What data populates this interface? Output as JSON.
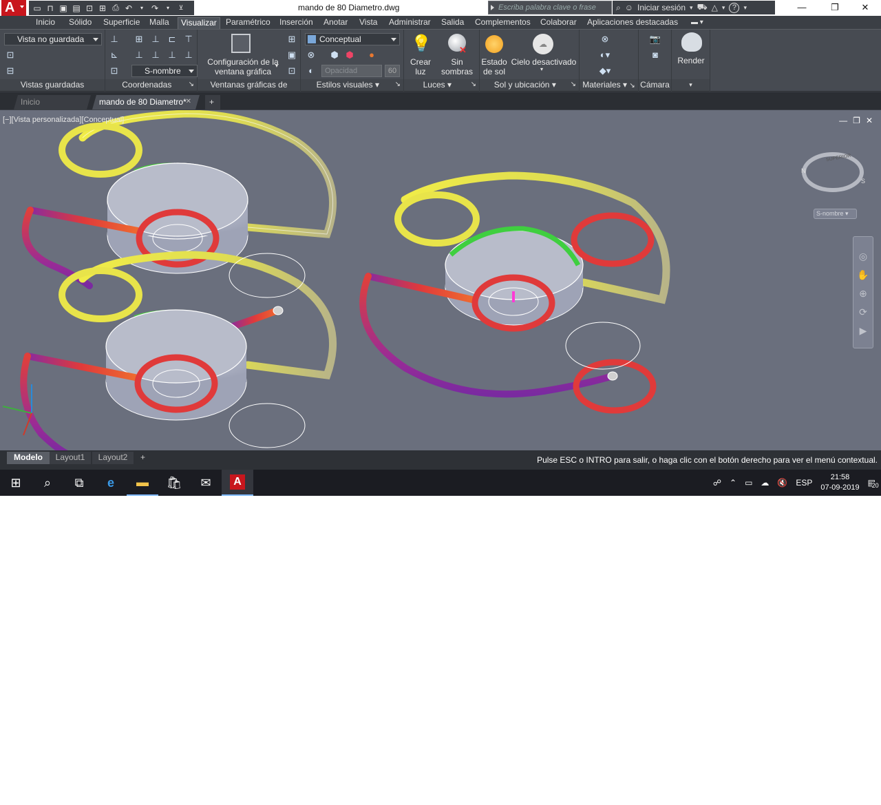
{
  "window": {
    "app_logo": "A",
    "document_title": "mando de 80 Diametro.dwg",
    "search_placeholder": "Escriba palabra clave o frase",
    "signin_label": "Iniciar sesión",
    "help_label": "?"
  },
  "ribbon_tabs": [
    "Inicio",
    "Sólido",
    "Superficie",
    "Malla",
    "Visualizar",
    "Paramétrico",
    "Inserción",
    "Anotar",
    "Vista",
    "Administrar",
    "Salida",
    "Complementos",
    "Colaborar",
    "Aplicaciones destacadas"
  ],
  "ribbon_active_tab": "Visualizar",
  "ribbon": {
    "views_dropdown": "Vista no guardada",
    "views_label": "Vistas guardadas",
    "ucs_dropdown": "S-nombre",
    "coords_label": "Coordenadas",
    "viewport_config_label_1": "Configuración de la",
    "viewport_config_label_2": "ventana gráfica",
    "model_viewports_label": "Ventanas gráficas de modelo",
    "visual_style_dropdown": "Conceptual",
    "opacity_placeholder": "Opacidad",
    "opacity_value": "60",
    "visual_styles_label": "Estilos visuales",
    "create_light_1": "Crear",
    "create_light_2": "luz",
    "no_shadows_1": "Sin",
    "no_shadows_2": "sombras",
    "lights_label": "Luces",
    "sun_status_1": "Estado",
    "sun_status_2": "de sol",
    "sky_off": "Cielo desactivado",
    "sun_location_label": "Sol y ubicación",
    "materials_label": "Materiales",
    "camera_label": "Cámara",
    "render_label": "Render"
  },
  "file_tabs": {
    "home": "Inicio",
    "current": "mando de 80 Diametro*",
    "close": "✕",
    "new": "+"
  },
  "viewport": {
    "label": "[−][Vista personalizada][Conceptual]",
    "viewcube_face": "SUPERIOR",
    "compass_n": "N",
    "compass_s": "S",
    "ucs_name": "S-nombre"
  },
  "layout_tabs": [
    "Modelo",
    "Layout1",
    "Layout2"
  ],
  "layout_active": "Modelo",
  "command_message": "Pulse ESC o INTRO para salir, o haga clic con el botón derecho para ver el menú contextual.",
  "taskbar": {
    "language": "ESP",
    "time": "21:58",
    "date": "07-09-2019",
    "notifications": "20",
    "autocad_letter": "A"
  },
  "colors": {
    "viewport_bg": "#6a6f7d",
    "ribbon_bg": "#474b52",
    "accent_red": "#c8161d",
    "tube_yellow": "#e6e24a",
    "tube_red": "#e0403a",
    "tube_purple": "#8a2b9e",
    "disk_gray": "#b8bccb"
  }
}
